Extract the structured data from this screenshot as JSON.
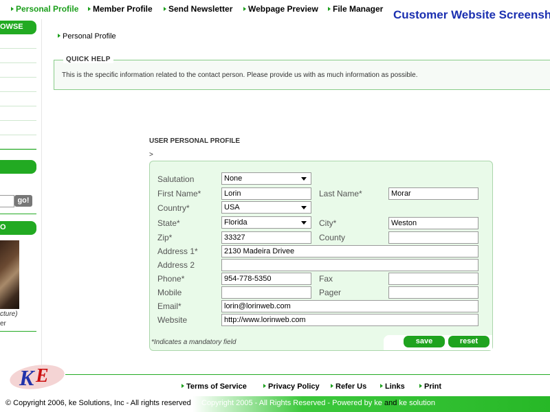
{
  "nav": {
    "items": [
      "Personal Profile",
      "Member Profile",
      "Send Newsletter",
      "Webpage Preview",
      "File Manager"
    ],
    "active_index": 0
  },
  "banner": {
    "text": "Customer Website Screenshot"
  },
  "sidebar": {
    "browse_tab": "OWSE",
    "search_button": "go!",
    "photo_tab": "O",
    "photo_caption": "cture)",
    "photo_name": "er"
  },
  "breadcrumb": {
    "text": "Personal Profile"
  },
  "quick_help": {
    "title": "QUICK HELP",
    "text": "This is the specific information related to the contact person. Please provide us with as much information as possible."
  },
  "form": {
    "title": "USER PERSONAL PROFILE",
    "arrow": ">",
    "labels": {
      "salutation": "Salutation",
      "first_name": "First Name*",
      "last_name": "Last Name*",
      "country": "Country*",
      "state": "State*",
      "city": "City*",
      "zip": "Zip*",
      "county": "County",
      "address1": "Address 1*",
      "address2": "Address 2",
      "phone": "Phone*",
      "fax": "Fax",
      "mobile": "Mobile",
      "pager": "Pager",
      "email": "Email*",
      "website": "Website"
    },
    "values": {
      "salutation": "None",
      "first_name": "Lorin",
      "last_name": "Morar",
      "country": "USA",
      "state": "Florida",
      "city": "Weston",
      "zip": "33327",
      "county": "",
      "address1": "2130 Madeira Drivee",
      "address2": "",
      "phone": "954-778-5350",
      "fax": "",
      "mobile": "",
      "pager": "",
      "email": "lorin@lorinweb.com",
      "website": "http://www.lorinweb.com"
    },
    "mandatory_note": "*Indicates a mandatory field",
    "save_label": "save",
    "reset_label": "reset"
  },
  "footer": {
    "links": [
      "Terms of Service",
      "Privacy Policy",
      "Refer Us",
      "Links",
      "Print"
    ],
    "copyright_left": "© Copyright 2006, ke Solutions, Inc - All rights reserved",
    "copyright_right_1": "Copyright 2005 - All Rights Reserved - Powered by ",
    "copyright_right_ke": "ke",
    "copyright_right_and": " and ",
    "copyright_right_2": "ke solution"
  },
  "colors": {
    "accent": "#22aa22",
    "banner": "#1a2fb0",
    "form_bg": "#e9fae9"
  }
}
